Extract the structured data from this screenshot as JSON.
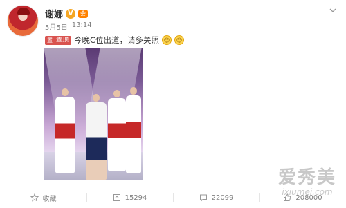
{
  "post": {
    "author": "谢娜",
    "verified_mark": "V",
    "vip_mark": "会",
    "date": "5月5日",
    "time": "13:14",
    "pinned_label": "置顶",
    "pinned_icon": "置",
    "text": "今晚C位出道，请多关照",
    "emojis": [
      "☺",
      "☺"
    ]
  },
  "actions": {
    "favorite": "收藏",
    "repost_count": "15294",
    "comment_count": "22099",
    "like_count": "208000"
  },
  "watermark": {
    "title": "爱秀美",
    "subtitle": "ixiumei.com"
  },
  "colors": {
    "accent": "#ff8200",
    "pinned": "#d9534f",
    "muted": "#808080"
  },
  "icons": [
    "chevron-down-icon",
    "star-icon",
    "repost-icon",
    "comment-icon",
    "like-icon"
  ]
}
